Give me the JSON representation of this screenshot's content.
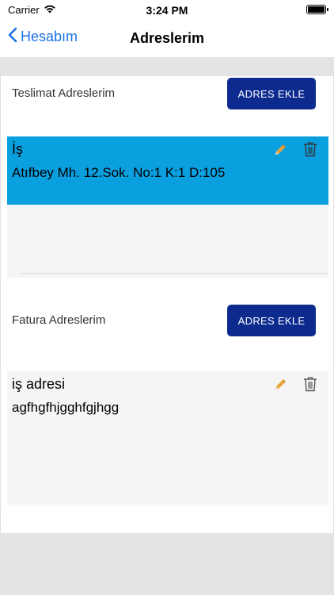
{
  "status_bar": {
    "carrier": "Carrier",
    "time": "3:24 PM",
    "icons": [
      "wifi-icon",
      "battery-icon"
    ]
  },
  "nav": {
    "back_label": "Hesabım",
    "title": "Adreslerim",
    "accent_color": "#1a73e8"
  },
  "delivery": {
    "section_title": "Teslimat Adreslerim",
    "add_button_label": "ADRES EKLE",
    "addresses": [
      {
        "title": "İş",
        "line": "Atıfbey Mh. 12.Sok. No:1 K:1 D:105",
        "selected": true,
        "highlight_color": "#0aa0e0"
      }
    ]
  },
  "billing": {
    "section_title": "Fatura Adreslerim",
    "add_button_label": "ADRES EKLE",
    "addresses": [
      {
        "title": "iş adresi",
        "line": "agfhgfhjgghfgjhgg",
        "selected": false
      }
    ]
  },
  "colors": {
    "button_bg": "#0d2b8f",
    "edit_icon": "#e8a23c",
    "trash_icon": "#555555"
  }
}
